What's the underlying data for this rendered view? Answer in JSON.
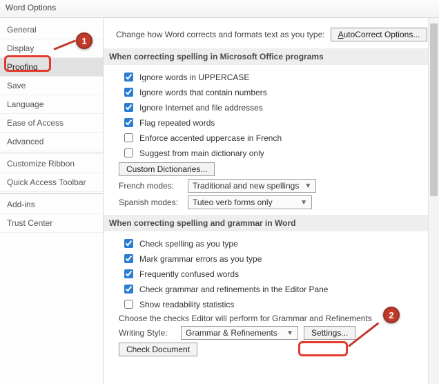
{
  "window": {
    "title": "Word Options"
  },
  "sidebar": {
    "items": [
      "General",
      "Display",
      "Proofing",
      "Save",
      "Language",
      "Ease of Access",
      "Advanced",
      "Customize Ribbon",
      "Quick Access Toolbar",
      "Add-ins",
      "Trust Center"
    ],
    "selected_index": 2
  },
  "intro": {
    "text": "Change how Word corrects and formats text as you type:",
    "autocorrect_btn": "AutoCorrect Options..."
  },
  "section1": {
    "heading": "When correcting spelling in Microsoft Office programs",
    "checks": [
      {
        "label": "Ignore words in UPPERCASE",
        "checked": true
      },
      {
        "label": "Ignore words that contain numbers",
        "checked": true
      },
      {
        "label": "Ignore Internet and file addresses",
        "checked": true
      },
      {
        "label": "Flag repeated words",
        "checked": true
      },
      {
        "label": "Enforce accented uppercase in French",
        "checked": false
      },
      {
        "label": "Suggest from main dictionary only",
        "checked": false
      }
    ],
    "custom_dict_btn": "Custom Dictionaries...",
    "french_label": "French modes:",
    "french_value": "Traditional and new spellings",
    "spanish_label": "Spanish modes:",
    "spanish_value": "Tuteo verb forms only"
  },
  "section2": {
    "heading": "When correcting spelling and grammar in Word",
    "checks": [
      {
        "label": "Check spelling as you type",
        "checked": true
      },
      {
        "label": "Mark grammar errors as you type",
        "checked": true
      },
      {
        "label": "Frequently confused words",
        "checked": true
      },
      {
        "label": "Check grammar and refinements in the Editor Pane",
        "checked": true
      },
      {
        "label": "Show readability statistics",
        "checked": false
      }
    ],
    "choose_text": "Choose the checks Editor will perform for Grammar and Refinements",
    "style_label": "Writing Style:",
    "style_value": "Grammar & Refinements",
    "settings_btn": "Settings...",
    "check_doc_btn": "Check Document"
  },
  "callouts": {
    "one": "1",
    "two": "2"
  }
}
